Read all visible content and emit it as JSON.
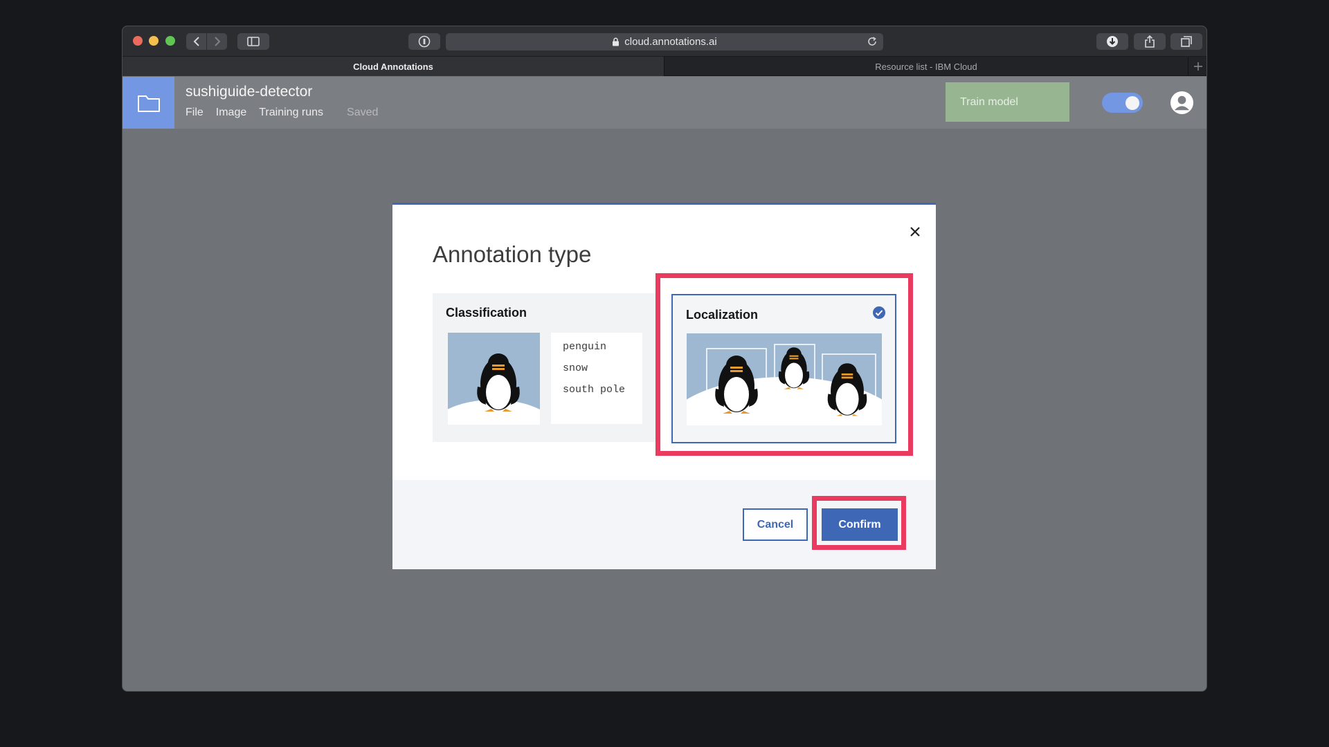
{
  "browser": {
    "url": "cloud.annotations.ai",
    "tabs": [
      {
        "label": "Cloud Annotations",
        "active": true
      },
      {
        "label": "Resource list - IBM Cloud",
        "active": false
      }
    ]
  },
  "app": {
    "project_title": "sushiguide-detector",
    "menu": [
      "File",
      "Image",
      "Training runs"
    ],
    "save_status": "Saved",
    "train_button": "Train model",
    "toggle_on": true
  },
  "modal": {
    "title": "Annotation type",
    "options": {
      "classification": {
        "title": "Classification",
        "labels": [
          "penguin",
          "snow",
          "south pole"
        ],
        "selected": false
      },
      "localization": {
        "title": "Localization",
        "selected": true
      }
    },
    "cancel_label": "Cancel",
    "confirm_label": "Confirm"
  },
  "colors": {
    "accent": "#3e67b5",
    "highlight": "#ea3a60",
    "train_button": "#96b590",
    "folder_tile": "#7497e3"
  }
}
